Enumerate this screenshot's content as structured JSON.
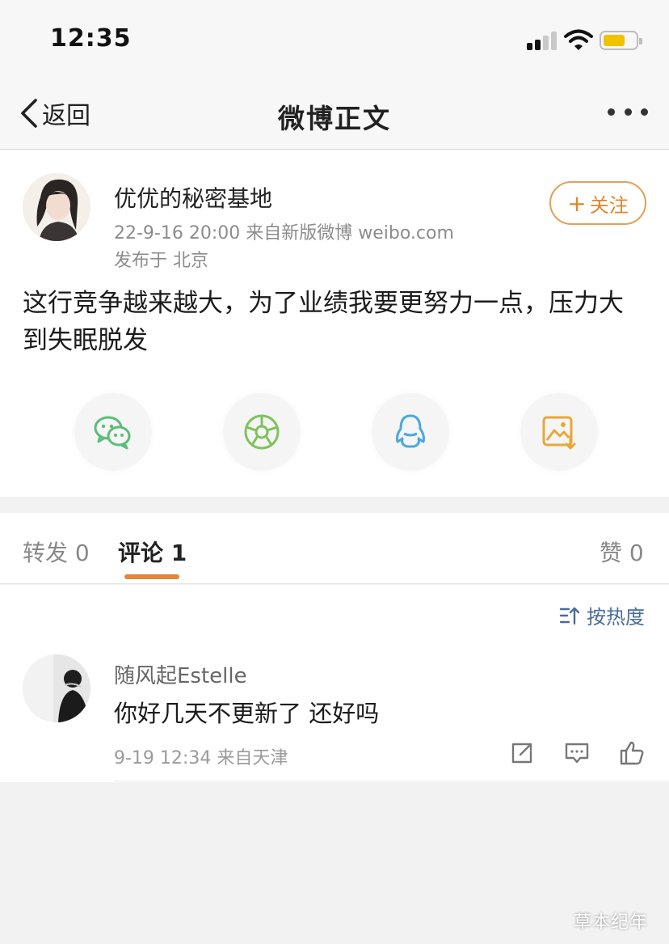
{
  "status_bar": {
    "time": "12:35",
    "signal_icon": "cellular-signal-icon",
    "wifi_icon": "wifi-icon",
    "battery_icon": "battery-icon",
    "battery_color": "#f2c100"
  },
  "nav": {
    "back_label": "返回",
    "title": "微博正文",
    "more_icon": "more-dots-icon"
  },
  "post": {
    "username": "优优的秘密基地",
    "meta": "22-9-16 20:00  来自新版微博 weibo.com",
    "location": "发布于 北京",
    "follow_label": "关注",
    "text": "这行竞争越来越大，为了业绩我要更努力一点，压力大到失眠脱发",
    "share_buttons": [
      {
        "icon": "wechat-icon",
        "color": "#5bbd7a"
      },
      {
        "icon": "moments-icon",
        "color": "#7fc25a"
      },
      {
        "icon": "qq-icon",
        "color": "#4aa8e0"
      },
      {
        "icon": "save-image-icon",
        "color": "#e7a83a"
      }
    ]
  },
  "tabs": {
    "repost": "转发 0",
    "comments": "评论 1",
    "likes": "赞 0",
    "accent": "#e2863b"
  },
  "comments": {
    "sort_label": "按热度",
    "items": [
      {
        "name": "随风起Estelle",
        "text": "你好几天不更新了 还好吗",
        "meta": "9-19 12:34  来自天津"
      }
    ]
  },
  "watermark": "草本纪年"
}
